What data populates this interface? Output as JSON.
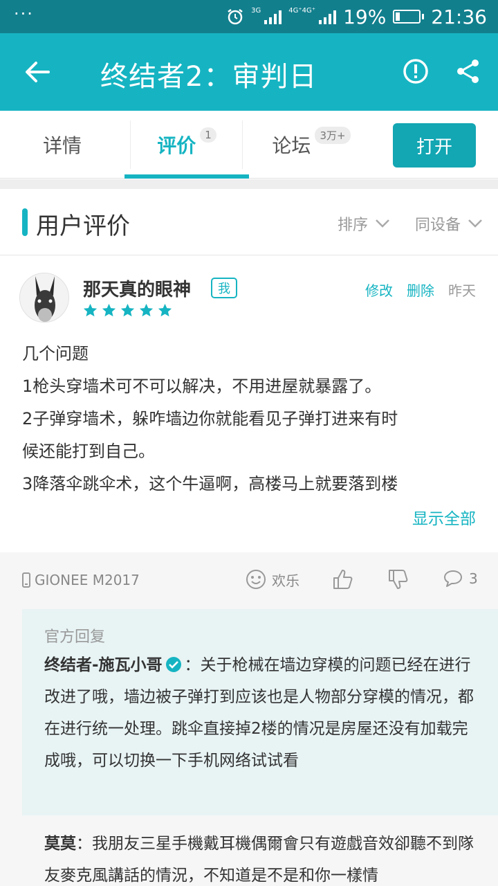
{
  "status_bar": {
    "dots": "···",
    "network_1": "3G",
    "network_2": "4G⁺4G⁺",
    "battery_level": 0.19,
    "battery_percent": "19%",
    "time": "21:36"
  },
  "app_bar": {
    "title": "终结者2：审判日"
  },
  "tabs": {
    "items": [
      {
        "label": "详情",
        "badge": ""
      },
      {
        "label": "评价",
        "badge": "1"
      },
      {
        "label": "论坛",
        "badge": "3万+"
      }
    ],
    "active_index": 1,
    "open_button": "打开"
  },
  "section": {
    "title": "用户评价",
    "sort_label": "排序",
    "device_filter": "同设备"
  },
  "review": {
    "username": "那天真的眼神",
    "me_badge": "我",
    "rating": 5,
    "edit": "修改",
    "delete": "删除",
    "date": "昨天",
    "lines": [
      "几个问题",
      "1枪头穿墙术可不可以解决，不用进屋就暴露了。",
      "2子弹穿墙术，躲咋墙边你就能看见子弹打进来有时",
      "候还能打到自己。",
      "3降落伞跳伞术，这个牛逼啊，高楼马上就要落到楼"
    ],
    "show_all": "显示全部",
    "device": "GIONEE M2017",
    "mood": "欢乐",
    "comment_count": "3"
  },
  "official_reply": {
    "label": "官方回复",
    "name": "终结者-施瓦小哥",
    "text": "：关于枪械在墙边穿模的问题已经在进行改进了哦，墙边被子弹打到应该也是人物部分穿模的情况，都在进行统一处理。跳伞直接掉2楼的情况是房屋还没有加载完成哦，可以切换一下手机网络试试看"
  },
  "reply_2": {
    "name": "莫莫",
    "text": "：我朋友三星手機戴耳機偶爾會只有遊戲音效卻聽不到隊友麥克風講話的情況，不知道是不是和你一樣情"
  },
  "colors": {
    "accent": "#16b4c2",
    "status_bar": "#127f8d",
    "official_bg": "#e8f3f4"
  }
}
